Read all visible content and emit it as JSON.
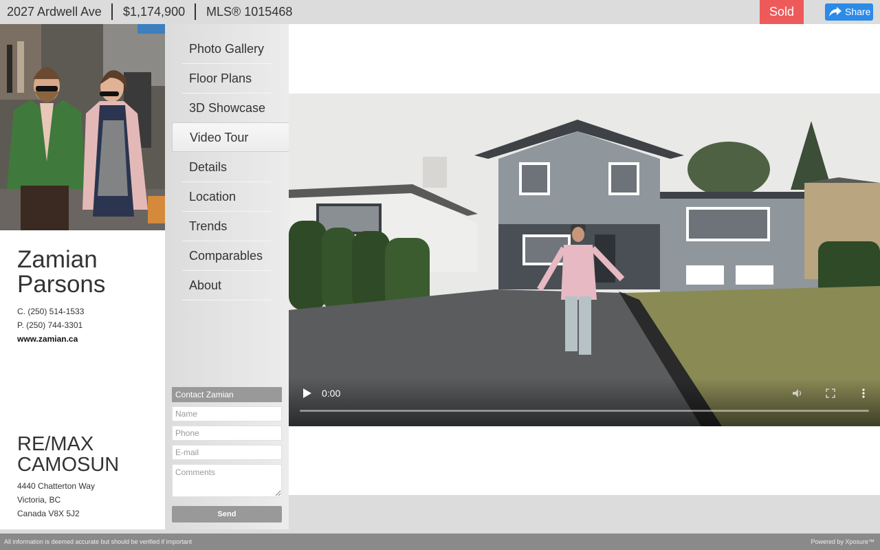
{
  "header": {
    "address": "2027 Ardwell Ave",
    "price": "$1,174,900",
    "mls": "MLS® 1015468",
    "status": "Sold",
    "share_label": "Share",
    "status_color": "#ee5a5a",
    "share_color": "#2d8ae6"
  },
  "agent": {
    "name_line1": "Zamian",
    "name_line2": "Parsons",
    "cell": "C. (250) 514-1533",
    "phone": "P. (250) 744-3301",
    "website": "www.zamian.ca",
    "brokerage_line1": "RE/MAX",
    "brokerage_line2": "CAMOSUN",
    "street": "4440 Chatterton Way",
    "city": "Victoria, BC",
    "country": "Canada V8X 5J2"
  },
  "nav": {
    "items": [
      {
        "label": "Photo Gallery"
      },
      {
        "label": "Floor Plans"
      },
      {
        "label": "3D Showcase"
      },
      {
        "label": "Video Tour",
        "active": true
      },
      {
        "label": "Details"
      },
      {
        "label": "Location"
      },
      {
        "label": "Trends"
      },
      {
        "label": "Comparables"
      },
      {
        "label": "About"
      }
    ]
  },
  "contact": {
    "heading": "Contact Zamian",
    "name_placeholder": "Name",
    "phone_placeholder": "Phone",
    "email_placeholder": "E-mail",
    "comments_placeholder": "Comments",
    "send_label": "Send"
  },
  "video": {
    "time": "0:00",
    "progress": 0,
    "icons": [
      "play-icon",
      "volume-icon",
      "fullscreen-icon",
      "more-options-icon"
    ]
  },
  "footer": {
    "disclaimer": "All information is deemed accurate but should be verified if important",
    "powered_by": "Powered by  Xposure™"
  }
}
